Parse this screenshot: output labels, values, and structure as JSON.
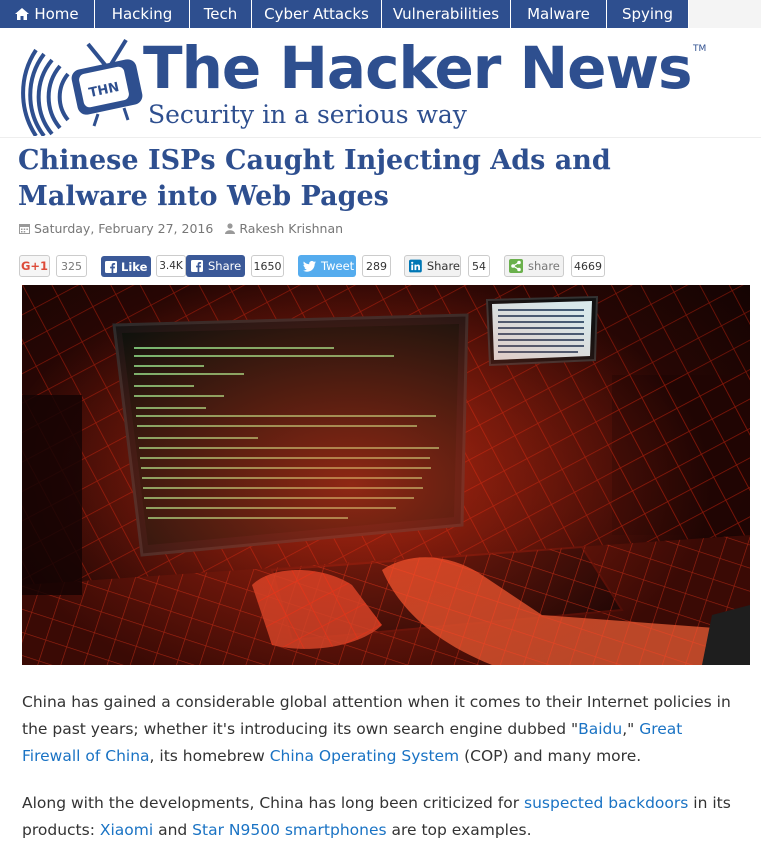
{
  "nav": {
    "items": [
      {
        "label": "Home"
      },
      {
        "label": "Hacking"
      },
      {
        "label": "Tech"
      },
      {
        "label": "Cyber Attacks"
      },
      {
        "label": "Vulnerabilities"
      },
      {
        "label": "Malware"
      },
      {
        "label": "Spying"
      }
    ]
  },
  "header": {
    "logo_badge": "THN",
    "brand": "The Hacker News",
    "trademark": "TM",
    "tagline": "Security in a serious way"
  },
  "article": {
    "title": "Chinese ISPs Caught Injecting Ads and Malware into Web Pages",
    "date": "Saturday, February 27, 2016",
    "author": "Rakesh Krishnan",
    "date_icon": "calendar-icon",
    "author_icon": "user-icon"
  },
  "share": {
    "gplus": {
      "label": "G+1",
      "count": "325"
    },
    "fb_like": {
      "label": "Like",
      "count": "3.4K"
    },
    "fb_share": {
      "label": "Share",
      "count": "1650"
    },
    "tweet": {
      "label": "Tweet",
      "count": "289"
    },
    "linkedin": {
      "label": "Share",
      "count": "54"
    },
    "generic": {
      "label": "share",
      "count": "4669"
    },
    "colors": {
      "facebook": "#3b5998",
      "twitter": "#55acee",
      "linkedin": "#0077b5",
      "gplus": "#dd4b39",
      "generic": "#6ab04c"
    }
  },
  "body": {
    "p1": {
      "t1": "China has gained a considerable global attention when it comes to their Internet policies in the past years; whether it's introducing its own search engine dubbed \"",
      "l1": "Baidu",
      "t2": ",\" ",
      "l2": "Great Firewall of China",
      "t3": ", its homebrew ",
      "l3": "China Operating System",
      "t4": " (COP) and many more."
    },
    "p2": {
      "t1": "Along with the developments, China has long been criticized for ",
      "l1": "suspected backdoors",
      "t2": " in its products: ",
      "l2": "Xiaomi",
      "t3": " and ",
      "l3": "Star N9500 smartphones",
      "t4": " are top examples."
    }
  },
  "colors": {
    "brand": "#2e4f8f",
    "link": "#1a73c4",
    "text": "#333333"
  }
}
